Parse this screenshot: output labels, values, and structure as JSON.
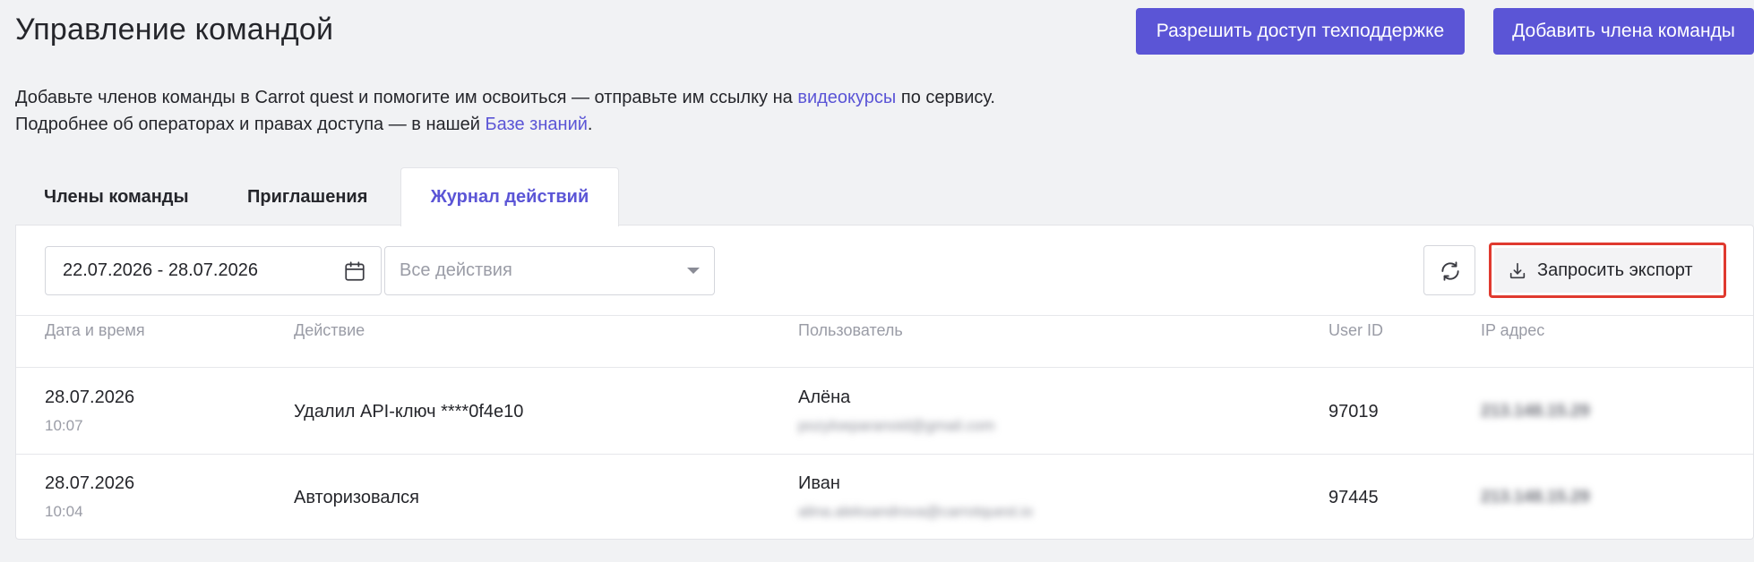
{
  "header": {
    "title": "Управление командой",
    "support_button": "Разрешить доступ техподдержке",
    "add_member_button": "Добавить члена команды"
  },
  "description": {
    "line1_prefix": "Добавьте членов команды в Carrot quest и помогите им освоиться — отправьте им ссылку на ",
    "line1_link": "видеокурсы",
    "line1_suffix": " по сервису.",
    "line2_prefix": "Подробнее об операторах и правах доступа — в нашей ",
    "line2_link": "Базе знаний",
    "line2_suffix": "."
  },
  "tabs": [
    {
      "label": "Члены команды",
      "active": false
    },
    {
      "label": "Приглашения",
      "active": false
    },
    {
      "label": "Журнал действий",
      "active": true
    }
  ],
  "filters": {
    "date_range": "22.07.2026 - 28.07.2026",
    "action_placeholder": "Все действия",
    "export_button": "Запросить экспорт"
  },
  "table": {
    "columns": [
      "Дата и время",
      "Действие",
      "Пользователь",
      "User ID",
      "IP адрес"
    ],
    "rows": [
      {
        "date": "28.07.2026",
        "time": "10:07",
        "action": "Удалил API-ключ ****0f4e10",
        "user_name": "Алёна",
        "user_email": "pozyloeparanoid@gmail.com",
        "user_id": "97019",
        "ip": "213.148.15.29"
      },
      {
        "date": "28.07.2026",
        "time": "10:04",
        "action": "Авторизовался",
        "user_name": "Иван",
        "user_email": "alina.aleksandrova@carrotquest.io",
        "user_id": "97445",
        "ip": "213.148.15.29"
      }
    ]
  },
  "colors": {
    "accent": "#5b55d6",
    "highlight_border": "#e03a2f",
    "background": "#f1f2f4"
  },
  "icons": {
    "calendar": "calendar-icon",
    "caret": "chevron-down-icon",
    "refresh": "refresh-icon",
    "download": "download-icon"
  }
}
